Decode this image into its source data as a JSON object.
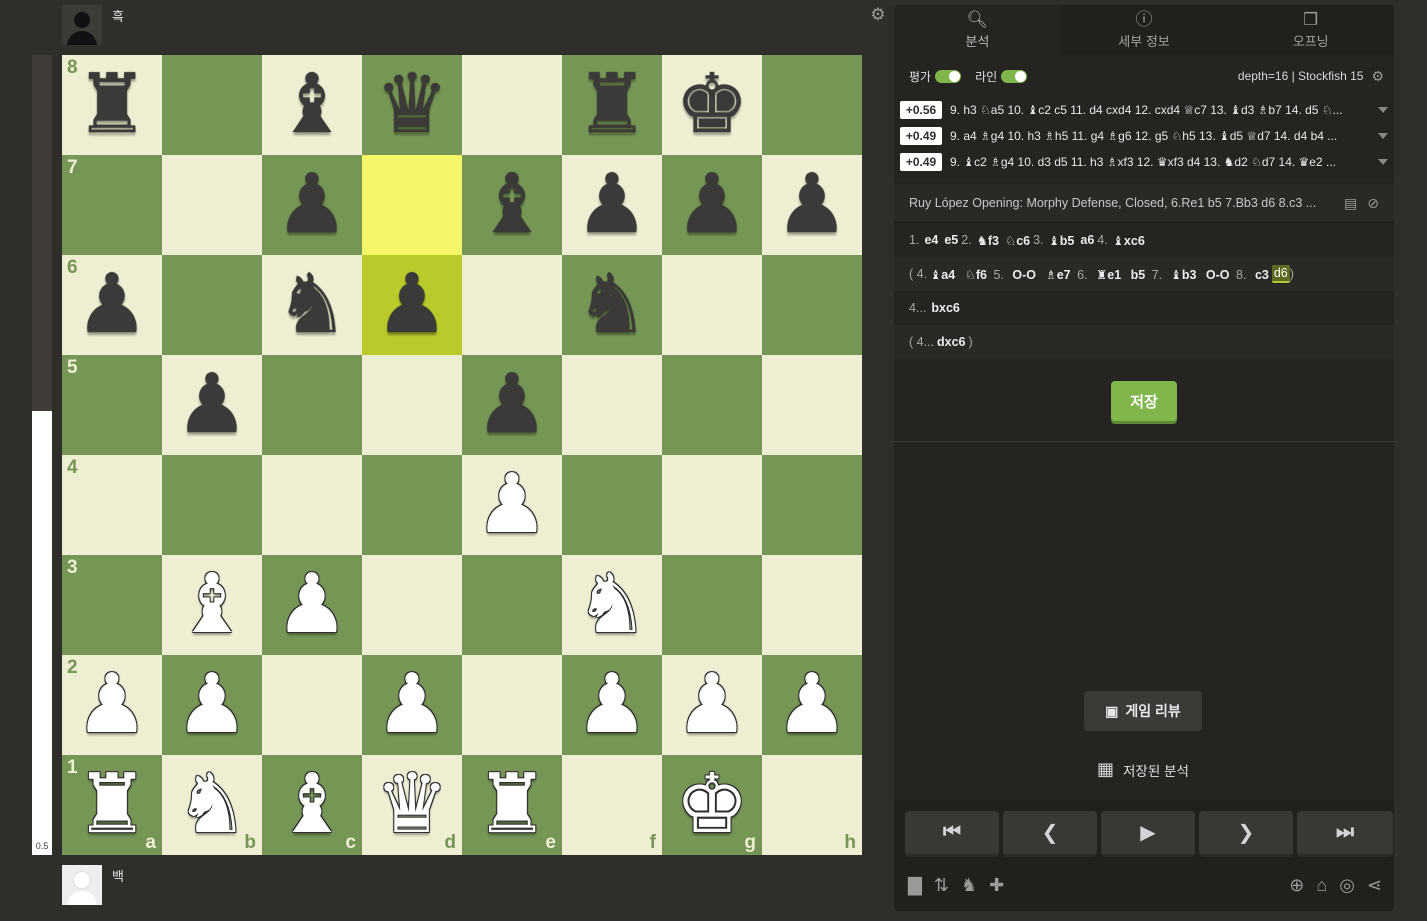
{
  "players": {
    "top": {
      "name": "흑"
    },
    "bottom": {
      "name": "백"
    }
  },
  "eval_bar": {
    "label": "0.5",
    "white_fraction": 0.555
  },
  "board": {
    "ranks": [
      "8",
      "7",
      "6",
      "5",
      "4",
      "3",
      "2",
      "1"
    ],
    "files": [
      "a",
      "b",
      "c",
      "d",
      "e",
      "f",
      "g",
      "h"
    ],
    "position": [
      [
        "r",
        "",
        "b",
        "q",
        "",
        "r",
        "k",
        ""
      ],
      [
        "",
        "",
        "p",
        "",
        "b",
        "p",
        "p",
        "p"
      ],
      [
        "p",
        "",
        "n",
        "p",
        "",
        "n",
        "",
        ""
      ],
      [
        "",
        "p",
        "",
        "",
        "p",
        "",
        "",
        ""
      ],
      [
        "",
        "",
        "",
        "",
        "P",
        "",
        "",
        ""
      ],
      [
        "",
        "B",
        "P",
        "",
        "",
        "N",
        "",
        ""
      ],
      [
        "P",
        "P",
        "",
        "P",
        "",
        "P",
        "P",
        "P"
      ],
      [
        "R",
        "N",
        "B",
        "Q",
        "R",
        "",
        "K",
        ""
      ]
    ],
    "highlight_squares": [
      "d7",
      "d6"
    ],
    "colors": {
      "light": "#eeeed2",
      "dark": "#769656",
      "highlight_light": "#f6f669",
      "highlight_dark": "#baca2b"
    }
  },
  "tabs": [
    {
      "label": "분석",
      "icon": "magnifier-icon",
      "active": true
    },
    {
      "label": "세부 정보",
      "icon": "info-icon",
      "active": false
    },
    {
      "label": "오프닝",
      "icon": "book-stack-icon",
      "active": false
    }
  ],
  "analysis": {
    "eval_toggle_label": "평가",
    "lines_toggle_label": "라인",
    "engine_info": "depth=16 | Stockfish 15",
    "lines": [
      {
        "score": "+0.56",
        "moves": "9. h3 ♘a5 10. ♝c2 c5 11. d4 cxd4 12. cxd4 ♕c7 13. ♝d3 ♗b7 14. d5 ♘..."
      },
      {
        "score": "+0.49",
        "moves": "9. a4 ♗g4 10. h3 ♗h5 11. g4 ♗g6 12. g5 ♘h5 13. ♝d5 ♕d7 14. d4 b4 ..."
      },
      {
        "score": "+0.49",
        "moves": "9. ♝c2 ♗g4 10. d3 d5 11. h3 ♗xf3 12. ♛xf3 d4 13. ♞d2 ♘d7 14. ♛e2 ..."
      }
    ],
    "opening": "Ruy López Opening: Morphy Defense, Closed, 6.Re1 b5 7.Bb3 d6 8.c3 ..."
  },
  "move_list": {
    "main": [
      {
        "num": "1.",
        "w": "e4",
        "b": "e5"
      },
      {
        "num": "2.",
        "w": "♞f3",
        "b": "♘c6"
      },
      {
        "num": "3.",
        "w": "♝b5",
        "b": "a6"
      },
      {
        "num": "4.",
        "w": "♝xc6",
        "b": ""
      }
    ],
    "variation1": {
      "open": "( 4.",
      "moves": [
        "♝a4",
        "♘f6",
        "5.",
        "O-O",
        "♗e7",
        "6.",
        "♜e1",
        "b5",
        "7.",
        "♝b3",
        "O-O",
        "8.",
        "c3"
      ],
      "current": "d6",
      "close": ")"
    },
    "continuation": {
      "num": "4...",
      "move": "bxc6"
    },
    "variation2": {
      "open": "( 4...",
      "move": "dxc6",
      "close": ")"
    }
  },
  "buttons": {
    "save": "저장",
    "game_review": "게임 리뷰",
    "saved_analysis": "저장된 분석"
  },
  "nav": {
    "first": "⏮",
    "prev": "❮",
    "play": "▶",
    "next": "❯",
    "last": "⏭"
  },
  "bottom_icons": {
    "left": [
      "bar-chart-icon",
      "flip-board-icon",
      "pieces-icon",
      "plus-icon"
    ],
    "right": [
      "zoom-icon",
      "explorer-icon",
      "target-icon",
      "share-icon"
    ]
  },
  "ui_colors": {
    "background": "#302e2b",
    "panel": "#262421",
    "accent_green": "#81b64c"
  }
}
